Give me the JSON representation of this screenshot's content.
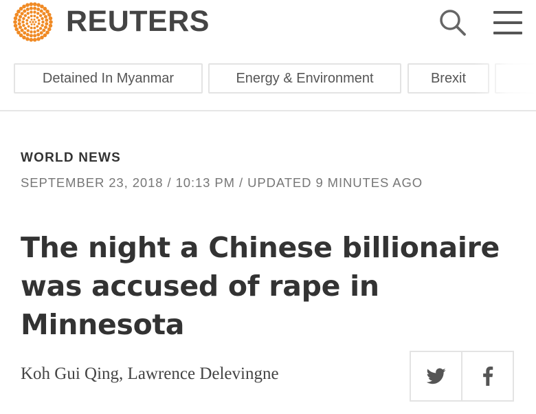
{
  "header": {
    "brand": "REUTERS",
    "logo_icon": "reuters-dot-logo",
    "search_icon": "search-icon",
    "menu_icon": "hamburger-menu-icon",
    "logo_color": "#f08a24"
  },
  "tabs": [
    {
      "label": "Detained In Myanmar"
    },
    {
      "label": "Energy & Environment"
    },
    {
      "label": "Brexit"
    }
  ],
  "article": {
    "section": "WORLD NEWS",
    "dateline": "SEPTEMBER 23, 2018 / 10:13 PM / UPDATED 9 MINUTES AGO",
    "headline": "The night a Chinese billionaire was accused of rape in Minnesota",
    "byline": "Koh Gui Qing, Lawrence Delevingne"
  },
  "share": {
    "twitter_icon": "twitter-icon",
    "facebook_icon": "facebook-icon"
  }
}
